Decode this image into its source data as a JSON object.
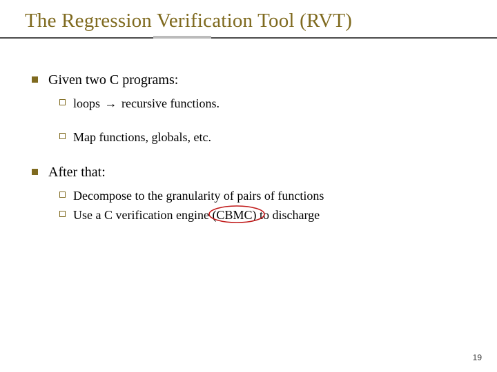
{
  "title": "The Regression Verification Tool (RVT)",
  "items": [
    {
      "text": "Given two C programs:",
      "sub": [
        {
          "text_before": "loops ",
          "arrow": "→",
          "text_after": " recursive functions."
        },
        {
          "gap": true
        },
        {
          "text": "Map functions, globals, etc."
        }
      ]
    },
    {
      "text": "After that:",
      "sub": [
        {
          "text": "Decompose to the granularity of pairs of functions"
        },
        {
          "text_before": "Use a C verification engine ",
          "circled": "(CBMC)",
          "text_after": " to discharge"
        }
      ]
    }
  ],
  "page_number": "19"
}
